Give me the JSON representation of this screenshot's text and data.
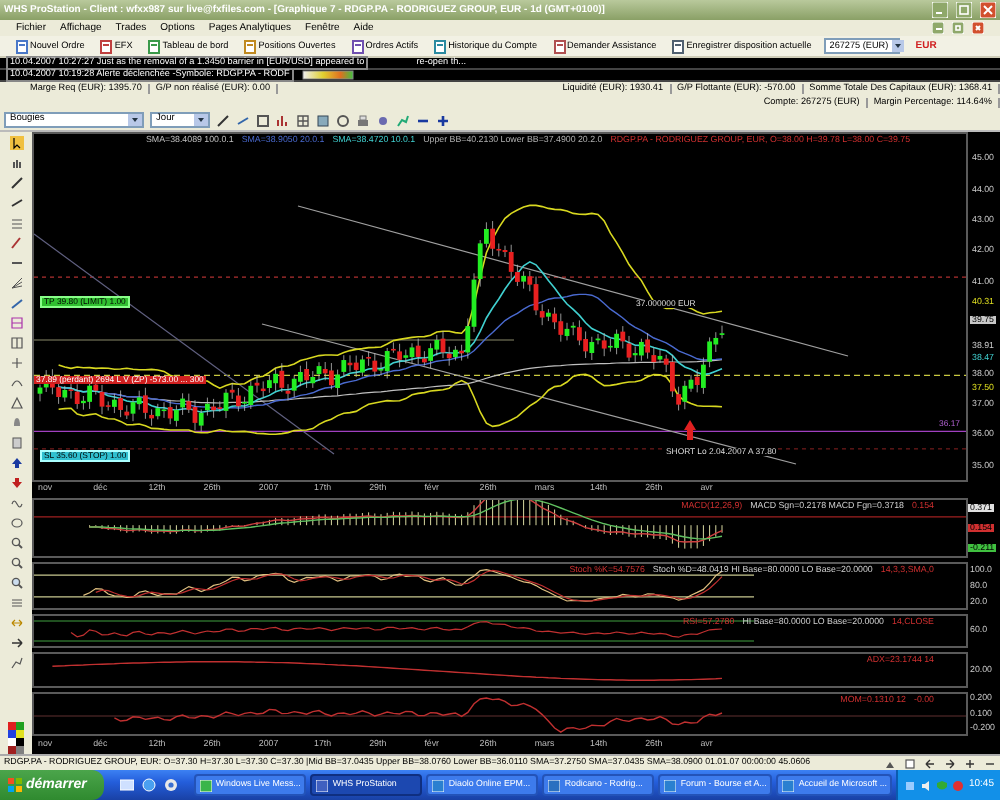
{
  "window": {
    "title": "WHS ProStation - Client : wfxx987 sur live@fxfiles.com - [Graphique 7 - RDGP.PA - RODRIGUEZ GROUP, EUR - 1d (GMT+0100)]"
  },
  "menu": [
    "Fichier",
    "Affichage",
    "Trades",
    "Options",
    "Pages Analytiques",
    "Fenêtre",
    "Aide"
  ],
  "toolbar": {
    "buttons": [
      "Nouvel Ordre",
      "EFX",
      "Tableau de bord",
      "Positions Ouvertes",
      "Ordres Actifs",
      "Historique du Compte",
      "Demander Assistance",
      "Enregistrer disposition actuelle"
    ],
    "account": "267275 (EUR)",
    "currency": "EUR"
  },
  "alerts": [
    {
      "text": "10.04.2007 10:27:27 Just as the removal of a 1.3450 barrier in [EUR/USD] appeared to",
      "tail": "re-open th..."
    },
    {
      "text": "10.04.2007 10:19:28 Alerte déclenchée -Symbole: RDGP.PA - RODF"
    }
  ],
  "account_info": [
    "Marge Req (EUR): 1395.70",
    "G/P non réalisé (EUR): 0.00",
    "Liquidité (EUR): 1930.41",
    "G/P Flottante (EUR): -570.00",
    "Somme Totale Des Capitaux (EUR): 1368.41"
  ],
  "account_summary": [
    "Compte: 267275 (EUR)",
    "Margin Percentage: 114.64%"
  ],
  "chart_toolbar": {
    "chart_type": "Bougies",
    "period": "Jour"
  },
  "chart": {
    "legend": [
      {
        "text": "SMA=38.4089 100.0.1",
        "kind": "sma-long"
      },
      {
        "text": "SMA=38.9050 20.0.1",
        "kind": "sma-mid"
      },
      {
        "text": "SMA=38.4720 10.0.1",
        "kind": "sma-short"
      },
      {
        "text": "Upper BB=40.2130 Lower BB=37.4900 20.2.0",
        "kind": "bollinger"
      },
      {
        "text": "RDGP.PA - RODRIGUEZ GROUP, EUR, O=38.00 H=39.78 L=38.00 C=39.75",
        "kind": "symbol"
      }
    ],
    "price_labels": [
      {
        "text": "45.00",
        "kind": "tick"
      },
      {
        "text": "44.00",
        "kind": "tick"
      },
      {
        "text": "43.00",
        "kind": "tick"
      },
      {
        "text": "42.00",
        "kind": "tick"
      },
      {
        "text": "41.00",
        "kind": "tick"
      },
      {
        "text": "40.31",
        "kind": "band"
      },
      {
        "text": "39.75",
        "kind": "last"
      },
      {
        "text": "38.91",
        "kind": "tick"
      },
      {
        "text": "38.47",
        "kind": "sma"
      },
      {
        "text": "38.00",
        "kind": "tick"
      },
      {
        "text": "37.50",
        "kind": "band"
      },
      {
        "text": "37.00",
        "kind": "tick"
      },
      {
        "text": "36.17",
        "kind": "support"
      },
      {
        "text": "36.00",
        "kind": "tick"
      },
      {
        "text": "35.00",
        "kind": "tick"
      }
    ],
    "annotations": [
      {
        "kind": "take-profit",
        "text": "TP 39.80 (LIMIT) 1.00"
      },
      {
        "kind": "position",
        "text": "37.89 (perdant) 2694 L V (ZP) -573.00 ... 300"
      },
      {
        "kind": "stop-loss",
        "text": "SL 35.60 (STOP) 1.00"
      },
      {
        "kind": "order",
        "text": "37.000000 EUR"
      },
      {
        "kind": "note",
        "text": "SHORT Lo 2.04.2007 A 37.80"
      }
    ],
    "dates": [
      "nov",
      "déc",
      "12th",
      "26th",
      "2007",
      "17th",
      "29th",
      "févr",
      "26th",
      "mars",
      "14th",
      "26th",
      "avr"
    ]
  },
  "indicators": [
    {
      "kind": "macd",
      "legend": [
        {
          "text": "MACD(12,26,9)",
          "kind": "name"
        },
        {
          "text": "MACD Sgn=0.2178 MACD Fgn=0.3718",
          "kind": "values"
        },
        {
          "text": "0.154",
          "kind": "name"
        }
      ],
      "axis": [
        {
          "text": "0.371",
          "kind": "macd-tag"
        },
        {
          "text": "0.154",
          "kind": "signal-tag"
        },
        {
          "text": "-0.211",
          "kind": "histogram-tag"
        }
      ]
    },
    {
      "kind": "stochastic",
      "legend": [
        {
          "text": "Stoch %K=54.7576",
          "kind": "name"
        },
        {
          "text": "Stoch %D=48.0419 HI Base=80.0000 LO Base=20.0000",
          "kind": "values"
        },
        {
          "text": "14,3,3,SMA,0",
          "kind": "name"
        }
      ],
      "axis": [
        {
          "text": "100.0",
          "kind": "tick"
        },
        {
          "text": "80.0",
          "kind": "tick"
        },
        {
          "text": "20.0",
          "kind": "tick"
        }
      ]
    },
    {
      "kind": "rsi",
      "legend": [
        {
          "text": "RSI=57.2780",
          "kind": "name"
        },
        {
          "text": "HI Base=80.0000 LO Base=20.0000",
          "kind": "values"
        },
        {
          "text": "14,CLOSE",
          "kind": "name"
        }
      ],
      "axis": [
        {
          "text": "60.0",
          "kind": "tick"
        }
      ]
    },
    {
      "kind": "adx",
      "legend": [
        {
          "text": "ADX=23.1744 14",
          "kind": "name"
        }
      ],
      "axis": [
        {
          "text": "20.00",
          "kind": "tick"
        }
      ]
    },
    {
      "kind": "momentum",
      "legend": [
        {
          "text": "MOM=0.1310 12",
          "kind": "name"
        },
        {
          "text": "-0.00",
          "kind": "name"
        }
      ],
      "axis": [
        {
          "text": "0.200",
          "kind": "tick"
        },
        {
          "text": "0.100",
          "kind": "tick"
        },
        {
          "text": "-0.200",
          "kind": "tick"
        }
      ]
    }
  ],
  "bottom_dates": [
    "nov",
    "déc",
    "12th",
    "26th",
    "2007",
    "17th",
    "29th",
    "févr",
    "26th",
    "mars",
    "14th",
    "26th",
    "avr"
  ],
  "status_bar": "RDGP.PA - RODRIGUEZ GROUP, EUR: O=37.30 H=37.30 L=37.30 C=37.30 |Mid BB=37.0435 Upper BB=38.0760 Lower BB=36.0110 SMA=37.2750 SMA=37.0435 SMA=38.0900 01.01.07 00:00:00 45.0606",
  "taskbar": {
    "start": "démarrer",
    "tasks": [
      {
        "label": "Windows Live Mess...",
        "selected": false
      },
      {
        "label": "WHS ProStation",
        "selected": true
      },
      {
        "label": "Diaolo Online EPM...",
        "selected": false
      },
      {
        "label": "Rodicano - Rodrig...",
        "selected": false
      },
      {
        "label": "Forum - Bourse et A...",
        "selected": false
      },
      {
        "label": "Accueil de Microsoft ...",
        "selected": false
      }
    ],
    "clock": "10:45"
  }
}
